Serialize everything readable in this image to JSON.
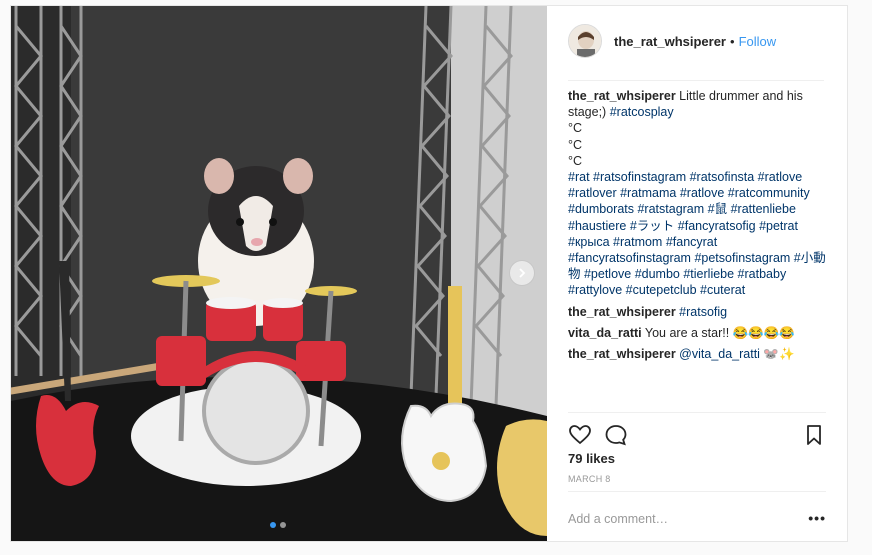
{
  "header": {
    "username": "the_rat_whsiperer",
    "separator": "•",
    "follow_label": "Follow"
  },
  "caption": {
    "username": "the_rat_whsiperer",
    "text": "Little drummer and his stage;)",
    "first_tag": "#ratcosplay",
    "lines": [
      "°C",
      "°C",
      "°C"
    ],
    "hashtags": "#rat #ratsofinstagram #ratsofinsta #ratlove #ratlover #ratmama #ratlove #ratcommunity #dumborats #ratstagram #鼠 #rattenliebe #haustiere #ラット #fancyratsofig #petrat #крыса #ratmom #fancyrat #fancyratsofinstagram #petsofinstagram #小動物 #petlove #dumbo #tierliebe #ratbaby #rattylove #cutepetclub #cuterat"
  },
  "comments": [
    {
      "username": "the_rat_whsiperer",
      "text": "#ratsofig",
      "is_tag": true
    },
    {
      "username": "vita_da_ratti",
      "text": "You are a star!! 😂😂😂😂",
      "is_tag": false
    },
    {
      "username": "the_rat_whsiperer",
      "text": "@vita_da_ratti 🐭✨",
      "is_tag": true
    }
  ],
  "likes_label": "79 likes",
  "date_label": "MARCH 8",
  "add_comment_placeholder": "Add a comment…",
  "more_label": "•••",
  "carousel": {
    "total": 2,
    "active": 1
  },
  "icons": {
    "like": "heart-icon",
    "comment": "comment-icon",
    "save": "bookmark-icon",
    "next": "chevron-right-icon"
  },
  "colors": {
    "link": "#3897f0",
    "hashtag": "#003569",
    "text": "#262626",
    "muted": "#999999"
  }
}
